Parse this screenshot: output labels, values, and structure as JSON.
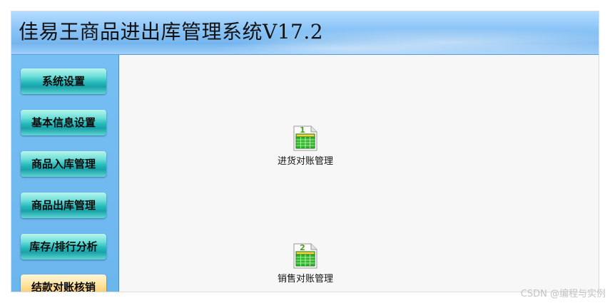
{
  "app": {
    "title": "佳易王商品进出库管理系统V17.2"
  },
  "sidebar": {
    "items": [
      {
        "label": "系统设置",
        "active": false
      },
      {
        "label": "基本信息设置",
        "active": false
      },
      {
        "label": "商品入库管理",
        "active": false
      },
      {
        "label": "商品出库管理",
        "active": false
      },
      {
        "label": "库存/排行分析",
        "active": false
      },
      {
        "label": "结款对账核销",
        "active": true
      }
    ]
  },
  "content": {
    "items": [
      {
        "number": "1",
        "label": "进货对账管理",
        "icon": "spreadsheet-icon"
      },
      {
        "number": "2",
        "label": "销售对账管理",
        "icon": "spreadsheet-icon"
      }
    ]
  },
  "watermark": "CSDN @编程与实例",
  "colors": {
    "sidebar_bg": "#6cb6ee",
    "nav_button_teal": "#25b9bb",
    "nav_button_active": "#ffce6e",
    "content_bg": "#f7f7f7"
  }
}
